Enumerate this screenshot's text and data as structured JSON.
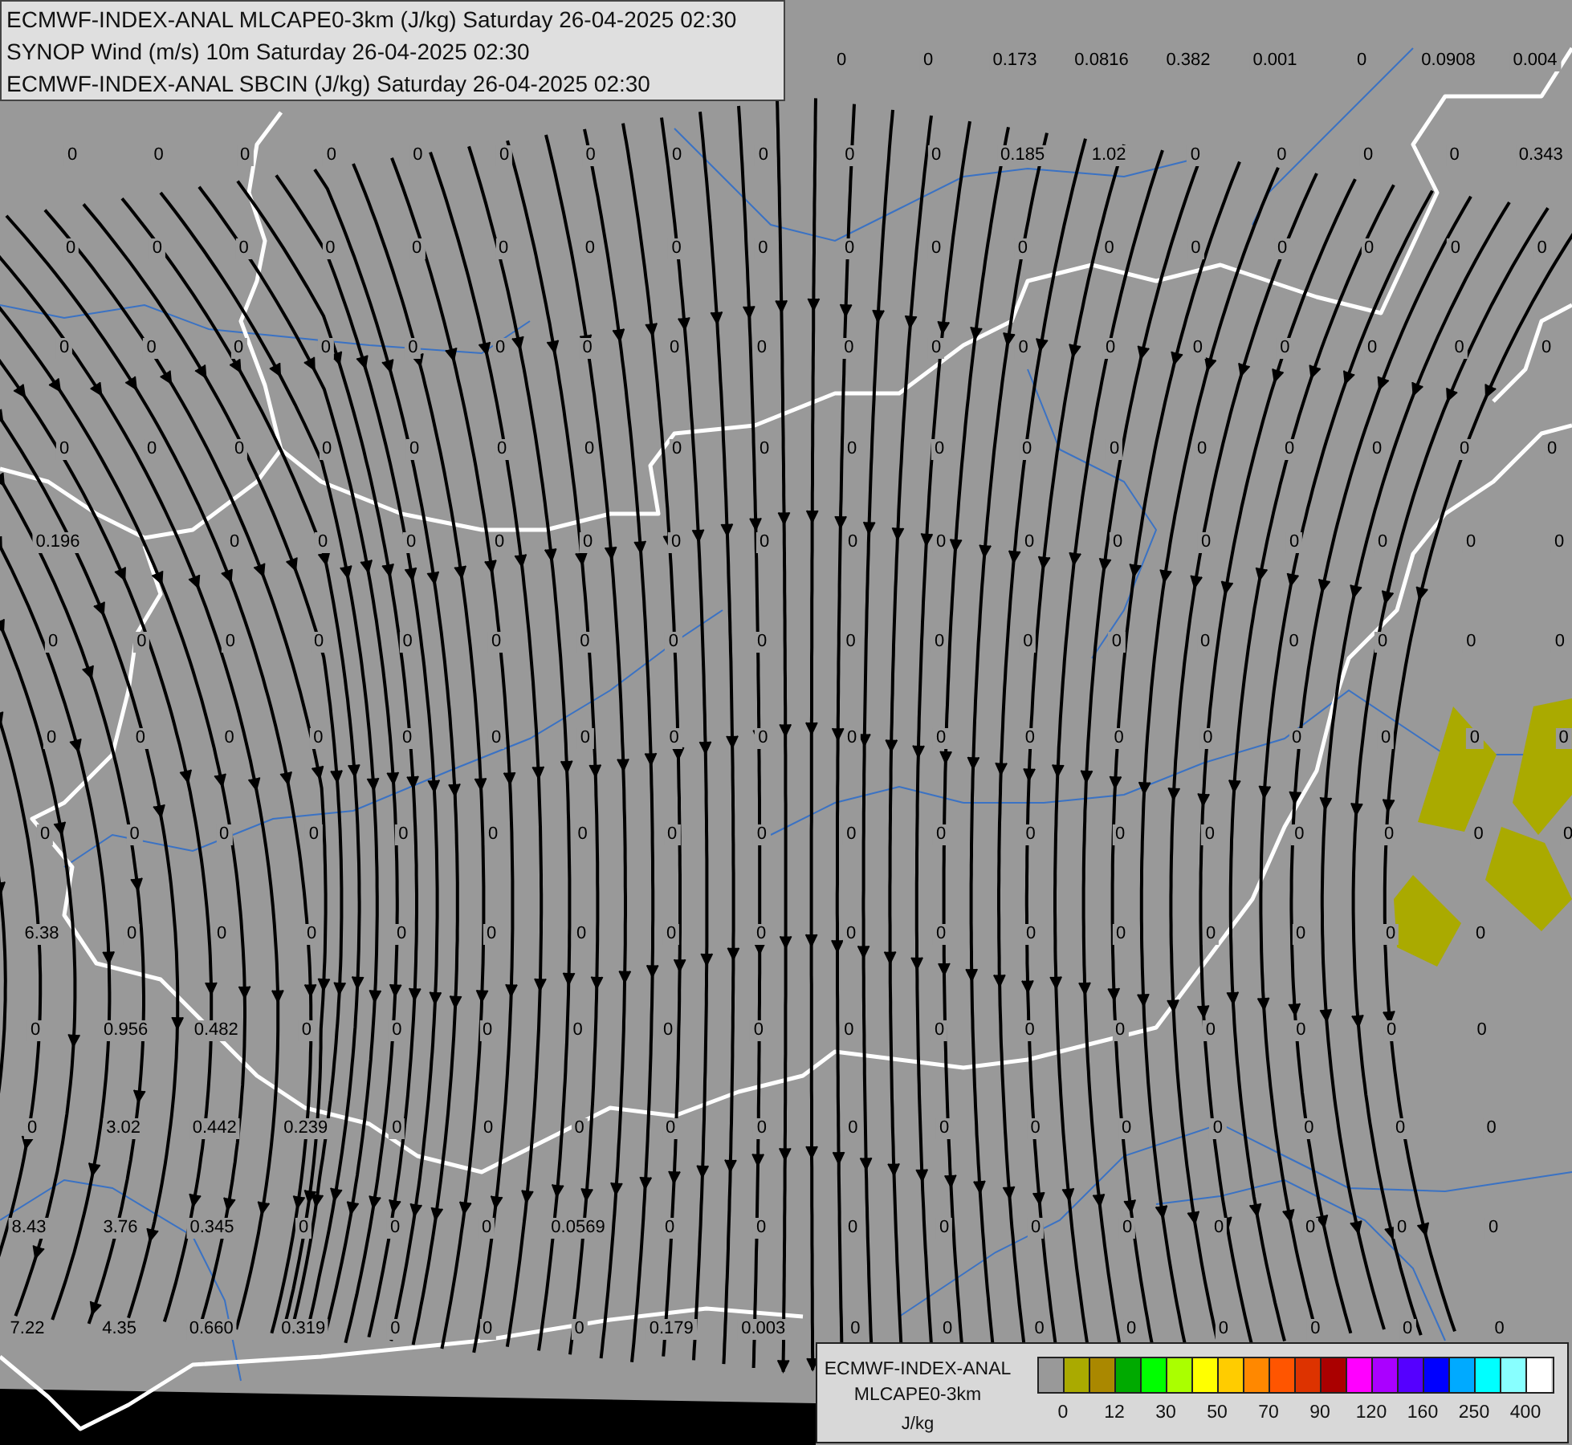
{
  "title_box": {
    "lines": [
      "ECMWF-INDEX-ANAL MLCAPE0-3km (J/kg) Saturday 26-04-2025 02:30",
      "SYNOP Wind (m/s) 10m Saturday 26-04-2025 02:30",
      "ECMWF-INDEX-ANAL SBCIN (J/kg) Saturday 26-04-2025 02:30"
    ]
  },
  "stations": {
    "rows": [
      [
        null,
        null,
        null,
        null,
        null,
        null,
        null,
        null,
        null,
        "0",
        "0",
        "0.173",
        "0.0816",
        "0.382",
        "0.001",
        "0",
        "0.0908",
        "0.004"
      ],
      [
        "0",
        "0",
        "0",
        "0",
        "0",
        "0",
        "0",
        "0",
        "0",
        "0",
        "0",
        "0.185",
        "1.02",
        "0",
        "0",
        "0",
        "0",
        "0.343"
      ],
      [
        "0",
        "0",
        "0",
        "0",
        "0",
        "0",
        "0",
        "0",
        "0",
        "0",
        "0",
        "0",
        "0",
        "0",
        "0",
        "0",
        "0",
        "0"
      ],
      [
        "0",
        "0",
        "0",
        "0",
        "0",
        "0",
        "0",
        "0",
        "0",
        "0",
        "0",
        "0",
        "0",
        "0",
        "0",
        "0",
        "0",
        "0"
      ],
      [
        "0",
        "0",
        "0",
        "0",
        "0",
        "0",
        "0",
        "0",
        "0",
        "0",
        "0",
        "0",
        "0",
        "0",
        "0",
        "0",
        "0",
        "0"
      ],
      [
        "0.196",
        null,
        "0",
        "0",
        "0",
        "0",
        "0",
        "0",
        "0",
        "0",
        "0",
        "0",
        "0",
        "0",
        "0",
        "0",
        "0",
        "0"
      ],
      [
        "0",
        "0",
        "0",
        "0",
        "0",
        "0",
        "0",
        "0",
        "0",
        "0",
        "0",
        "0",
        "0",
        "0",
        "0",
        "0",
        "0",
        "0"
      ],
      [
        "0",
        "0",
        "0",
        "0",
        "0",
        "0",
        "0",
        "0",
        "0",
        "0",
        "0",
        "0",
        "0",
        "0",
        "0",
        "0",
        "0",
        "0"
      ],
      [
        "0",
        "0",
        "0",
        "0",
        "0",
        "0",
        "0",
        "0",
        "0",
        "0",
        "0",
        "0",
        "0",
        "0",
        "0",
        "0",
        "0",
        "0"
      ],
      [
        "6.38",
        "0",
        "0",
        "0",
        "0",
        "0",
        "0",
        "0",
        "0",
        "0",
        "0",
        "0",
        "0",
        "0",
        "0",
        "0",
        "0"
      ],
      [
        "0",
        "0.956",
        "0.482",
        "0",
        "0",
        "0",
        "0",
        "0",
        "0",
        "0",
        "0",
        "0",
        "0",
        "0",
        "0",
        "0",
        "0"
      ],
      [
        "0",
        "3.02",
        "0.442",
        "0.239",
        "0",
        "0",
        "0",
        "0",
        "0",
        "0",
        "0",
        "0",
        "0",
        "0",
        "0",
        "0",
        "0"
      ],
      [
        "8.43",
        "3.76",
        "0.345",
        "0",
        "0",
        "0",
        "0.0569",
        "0",
        "0",
        "0",
        "0",
        "0",
        "0",
        "0",
        "0",
        "0",
        "0"
      ],
      [
        "7.22",
        "4.35",
        "0.660",
        "0.319",
        "0",
        "0",
        "0",
        "0.179",
        "0.003",
        "0",
        "0",
        "0",
        "0",
        "0",
        "0",
        "0",
        "0"
      ]
    ]
  },
  "legend": {
    "title_lines": [
      "ECMWF-INDEX-ANAL",
      "MLCAPE0-3km"
    ],
    "unit": "J/kg",
    "swatches": [
      {
        "color": "#999999"
      },
      {
        "color": "#aaaa00"
      },
      {
        "color": "#aa8800"
      },
      {
        "color": "#00aa00"
      },
      {
        "color": "#00ff00"
      },
      {
        "color": "#aaff00"
      },
      {
        "color": "#ffff00"
      },
      {
        "color": "#ffcc00"
      },
      {
        "color": "#ff8800"
      },
      {
        "color": "#ff5500"
      },
      {
        "color": "#dd3300"
      },
      {
        "color": "#aa0000"
      },
      {
        "color": "#ff00ff"
      },
      {
        "color": "#aa00ff"
      },
      {
        "color": "#5500ff"
      },
      {
        "color": "#0000ff"
      },
      {
        "color": "#00aaff"
      },
      {
        "color": "#00ffff"
      },
      {
        "color": "#88ffff"
      },
      {
        "color": "#ffffff"
      }
    ],
    "ticks": [
      "0",
      "12",
      "30",
      "50",
      "70",
      "90",
      "120",
      "160",
      "250",
      "400"
    ]
  }
}
